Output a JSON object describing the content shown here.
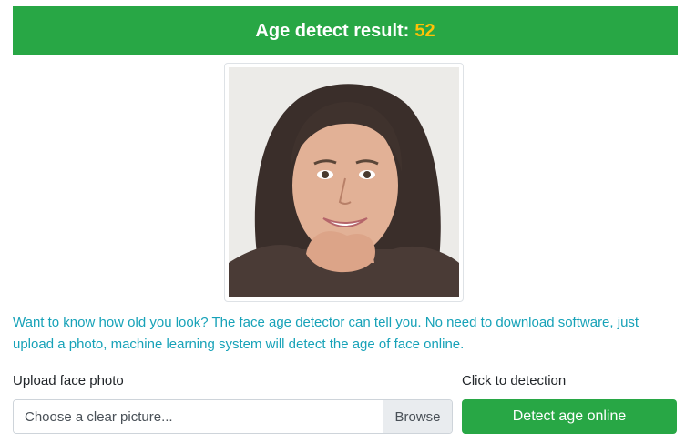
{
  "result": {
    "label": "Age detect result:",
    "age": "52"
  },
  "photo": {
    "alt_icon": "face-photo"
  },
  "description": "Want to know how old you look? The face age detector can tell you. No need to download software, just upload a photo, machine learning system will detect the age of face online.",
  "upload": {
    "label": "Upload face photo",
    "placeholder": "Choose a clear picture...",
    "browse_label": "Browse"
  },
  "detect": {
    "label": "Click to detection",
    "button_label": "Detect age online"
  },
  "colors": {
    "success": "#28a745",
    "warning": "#ffc107",
    "info": "#17a2b8"
  }
}
